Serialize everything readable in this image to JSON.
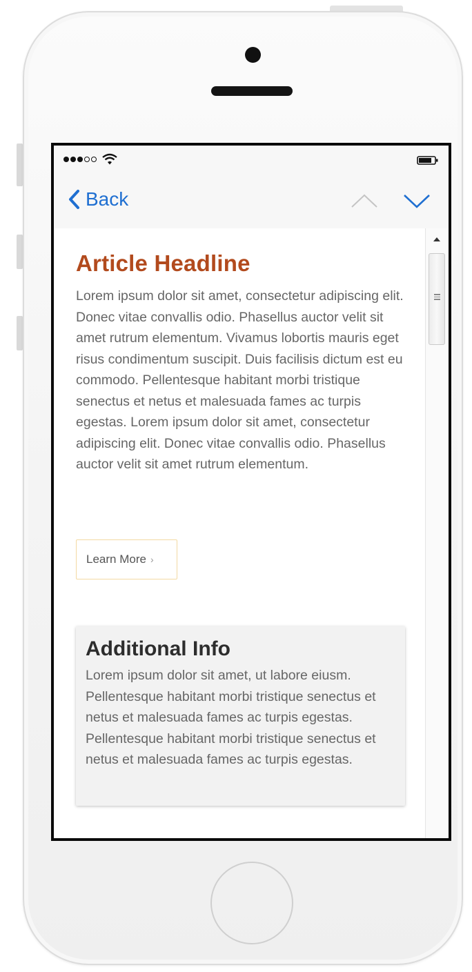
{
  "nav": {
    "back_label": "Back",
    "accent_color": "#1f6fd1"
  },
  "status": {
    "signal_bars_filled": 3,
    "signal_bars_total": 5,
    "icons": [
      "signal-dots-icon",
      "wifi-icon",
      "battery-icon"
    ]
  },
  "article": {
    "headline": "Article Headline",
    "headline_color": "#b24a1d",
    "body": "Lorem ipsum dolor sit amet, consectetur adipiscing elit. Donec vitae convallis odio. Phasellus auctor velit sit amet rutrum elementum. Vivamus lobortis mauris eget risus condimentum suscipit. Duis facilisis dictum est eu commodo. Pellentesque habitant morbi tristique senectus et netus et malesuada fames ac turpis egestas. Lorem ipsum dolor sit amet, consectetur adipiscing elit. Donec vitae convallis odio. Phasellus auctor velit sit amet rutrum elementum.",
    "learn_more_label": "Learn More",
    "learn_more_arrow": "›"
  },
  "additional": {
    "title": "Additional Info",
    "body": "Lorem ipsum dolor sit amet, ut labore eiusm. Pellentesque habitant morbi tristique senectus et netus et malesuada fames ac turpis egestas. Pellentesque habitant morbi tristique senectus et netus et malesuada fames ac turpis egestas."
  }
}
